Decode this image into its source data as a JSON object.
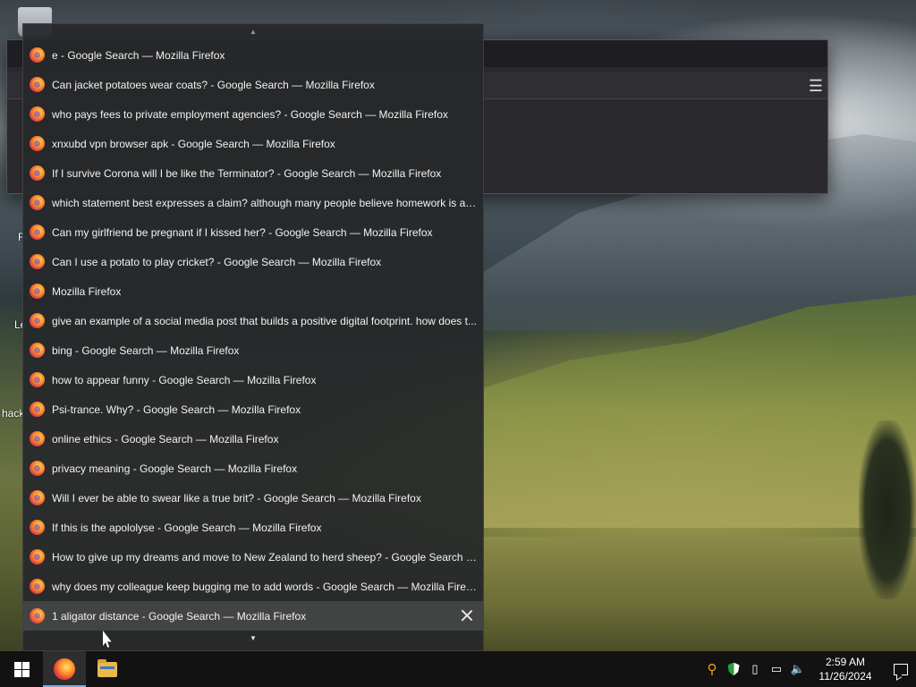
{
  "desktop": {
    "labels": [
      "Fi",
      "Le",
      "hack"
    ]
  },
  "history_menu": {
    "items": [
      {
        "title": "e - Google Search — Mozilla Firefox"
      },
      {
        "title": "Can jacket potatoes wear coats? - Google Search — Mozilla Firefox"
      },
      {
        "title": "who pays fees to private employment agencies? - Google Search — Mozilla Firefox"
      },
      {
        "title": "xnxubd vpn browser apk - Google Search — Mozilla Firefox"
      },
      {
        "title": "If I survive Corona will I be like the Terminator? - Google Search — Mozilla Firefox"
      },
      {
        "title": "which statement best expresses a claim? although many people believe homework is a c..."
      },
      {
        "title": "Can my girlfriend be pregnant if I kissed her? - Google Search — Mozilla Firefox"
      },
      {
        "title": "Can I use a potato to play cricket? - Google Search — Mozilla Firefox"
      },
      {
        "title": "Mozilla Firefox"
      },
      {
        "title": "give an example of a social media post that builds a positive digital footprint. how does t..."
      },
      {
        "title": "bing - Google Search — Mozilla Firefox"
      },
      {
        "title": "how to appear funny - Google Search — Mozilla Firefox"
      },
      {
        "title": "Psi-trance. Why? - Google Search — Mozilla Firefox"
      },
      {
        "title": "online ethics - Google Search — Mozilla Firefox"
      },
      {
        "title": "privacy meaning - Google Search — Mozilla Firefox"
      },
      {
        "title": "Will I ever be able to swear like a true brit? - Google Search — Mozilla Firefox"
      },
      {
        "title": "If this is the apololyse - Google Search — Mozilla Firefox"
      },
      {
        "title": "How to give up my dreams and move to New Zealand to herd sheep? - Google Search —..."
      },
      {
        "title": "why does my colleague keep bugging me to add words - Google Search — Mozilla Firefox"
      },
      {
        "title": "1 aligator distance - Google Search — Mozilla Firefox",
        "hovered": true
      }
    ],
    "scroll_up_icon": "chevron-up-icon",
    "scroll_down_icon": "chevron-down-icon",
    "close_icon": "close-icon"
  },
  "taskbar": {
    "start_icon": "windows-logo-icon",
    "pinned": [
      {
        "name": "firefox",
        "icon": "firefox-icon",
        "active": true
      },
      {
        "name": "file-explorer",
        "icon": "folder-icon",
        "active": false
      }
    ],
    "tray_icons": [
      "search-icon",
      "shield-icon",
      "usb-drive-icon",
      "network-icon",
      "volume-icon"
    ],
    "clock": {
      "time": "2:59 AM",
      "date": "11/26/2024"
    },
    "notification_icon": "notification-icon"
  }
}
